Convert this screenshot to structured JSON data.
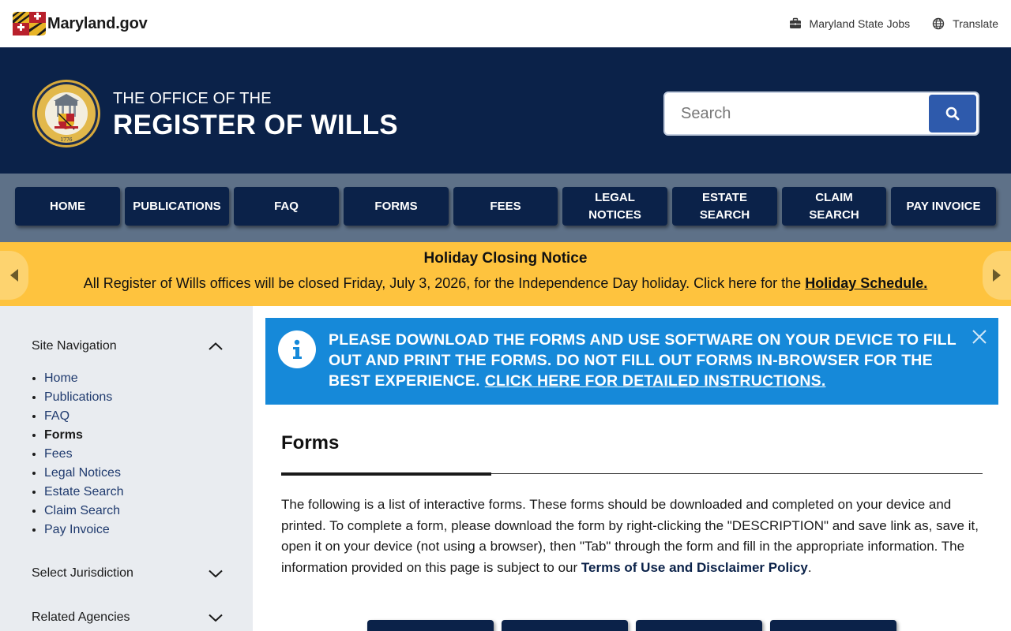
{
  "topbar": {
    "logo_text": "Maryland.gov",
    "jobs_label": "Maryland State Jobs",
    "translate_label": "Translate"
  },
  "header": {
    "title_small": "THE OFFICE OF THE",
    "title_big": "REGISTER OF WILLS",
    "search_placeholder": "Search"
  },
  "nav": {
    "items": [
      {
        "label": "HOME"
      },
      {
        "label": "PUBLICATIONS"
      },
      {
        "label": "FAQ"
      },
      {
        "label": "FORMS"
      },
      {
        "label": "FEES"
      },
      {
        "label": "LEGAL NOTICES"
      },
      {
        "label": "ESTATE SEARCH"
      },
      {
        "label": "CLAIM SEARCH"
      },
      {
        "label": "PAY INVOICE"
      }
    ]
  },
  "alert": {
    "title": "Holiday Closing Notice",
    "body": "All Register of Wills offices will be closed Friday, July 3, 2026, for the Independence Day holiday. Click here for the",
    "link": "Holiday Schedule."
  },
  "sidebar": {
    "site_nav_label": "Site Navigation",
    "items": [
      {
        "label": "Home"
      },
      {
        "label": "Publications"
      },
      {
        "label": "FAQ"
      },
      {
        "label": "Forms"
      },
      {
        "label": "Fees"
      },
      {
        "label": "Legal Notices"
      },
      {
        "label": "Estate Search"
      },
      {
        "label": "Claim Search"
      },
      {
        "label": "Pay Invoice"
      }
    ],
    "active_item": "Forms",
    "jurisdiction_label": "Select Jurisdiction",
    "agencies_label": "Related Agencies"
  },
  "info": {
    "text": "PLEASE DOWNLOAD THE FORMS AND USE SOFTWARE ON YOUR DEVICE TO FILL OUT AND PRINT THE FORMS. DO NOT FILL OUT FORMS IN-BROWSER FOR THE BEST EXPERIENCE.",
    "link": "CLICK HERE FOR DETAILED INSTRUCTIONS."
  },
  "main": {
    "title": "Forms",
    "intro": "The following is a list of interactive forms. These forms should be downloaded and completed on your device and printed. To complete a form, please download the form by right-clicking the \"DESCRIPTION\" and save link as, save it, open it on your device (not using a browser), then \"Tab\" through the form and fill in the appropriate information. The information provided on this page is subject to our",
    "intro_link": "Terms of Use and Disclaimer Policy",
    "intro_end": "."
  },
  "colors": {
    "header_bg": "#0b2249",
    "nav_bg": "#5e7188",
    "alert_bg": "#fec33e",
    "info_bg": "#1689d9",
    "sidebar_bg": "#e9ecf0",
    "search_button": "#2e5aac"
  },
  "icons": {
    "jobs": "briefcase-icon",
    "translate": "globe-icon",
    "search": "search-icon",
    "info": "info-icon",
    "close": "close-icon",
    "chevron_up": "chevron-up-icon",
    "chevron_down": "chevron-down-icon"
  }
}
